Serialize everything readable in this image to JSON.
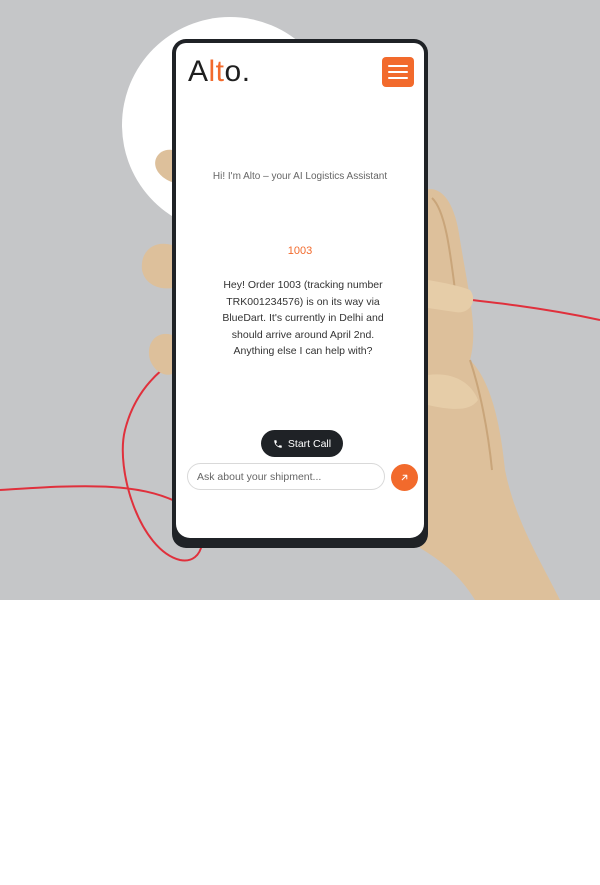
{
  "app": {
    "logo_prefix": "A",
    "logo_accent": "lt",
    "logo_suffix": "o."
  },
  "chat": {
    "greeting": "Hi! I'm Alto – your AI Logistics Assistant",
    "user_message": "1003",
    "bot_message": "Hey! Order 1003 (tracking number TRK001234576) is on its way via BlueDart. It's currently in Delhi and should arrive around April 2nd. Anything else I can help with?"
  },
  "controls": {
    "start_call_label": "Start Call",
    "input_placeholder": "Ask about your shipment...",
    "menu_icon": "hamburger-icon",
    "send_icon": "arrow-up-right-icon",
    "call_icon": "phone-icon"
  },
  "colors": {
    "accent": "#f26a2c",
    "dark": "#1f2226",
    "background": "#c5c6c8",
    "line": "#e0303c"
  }
}
